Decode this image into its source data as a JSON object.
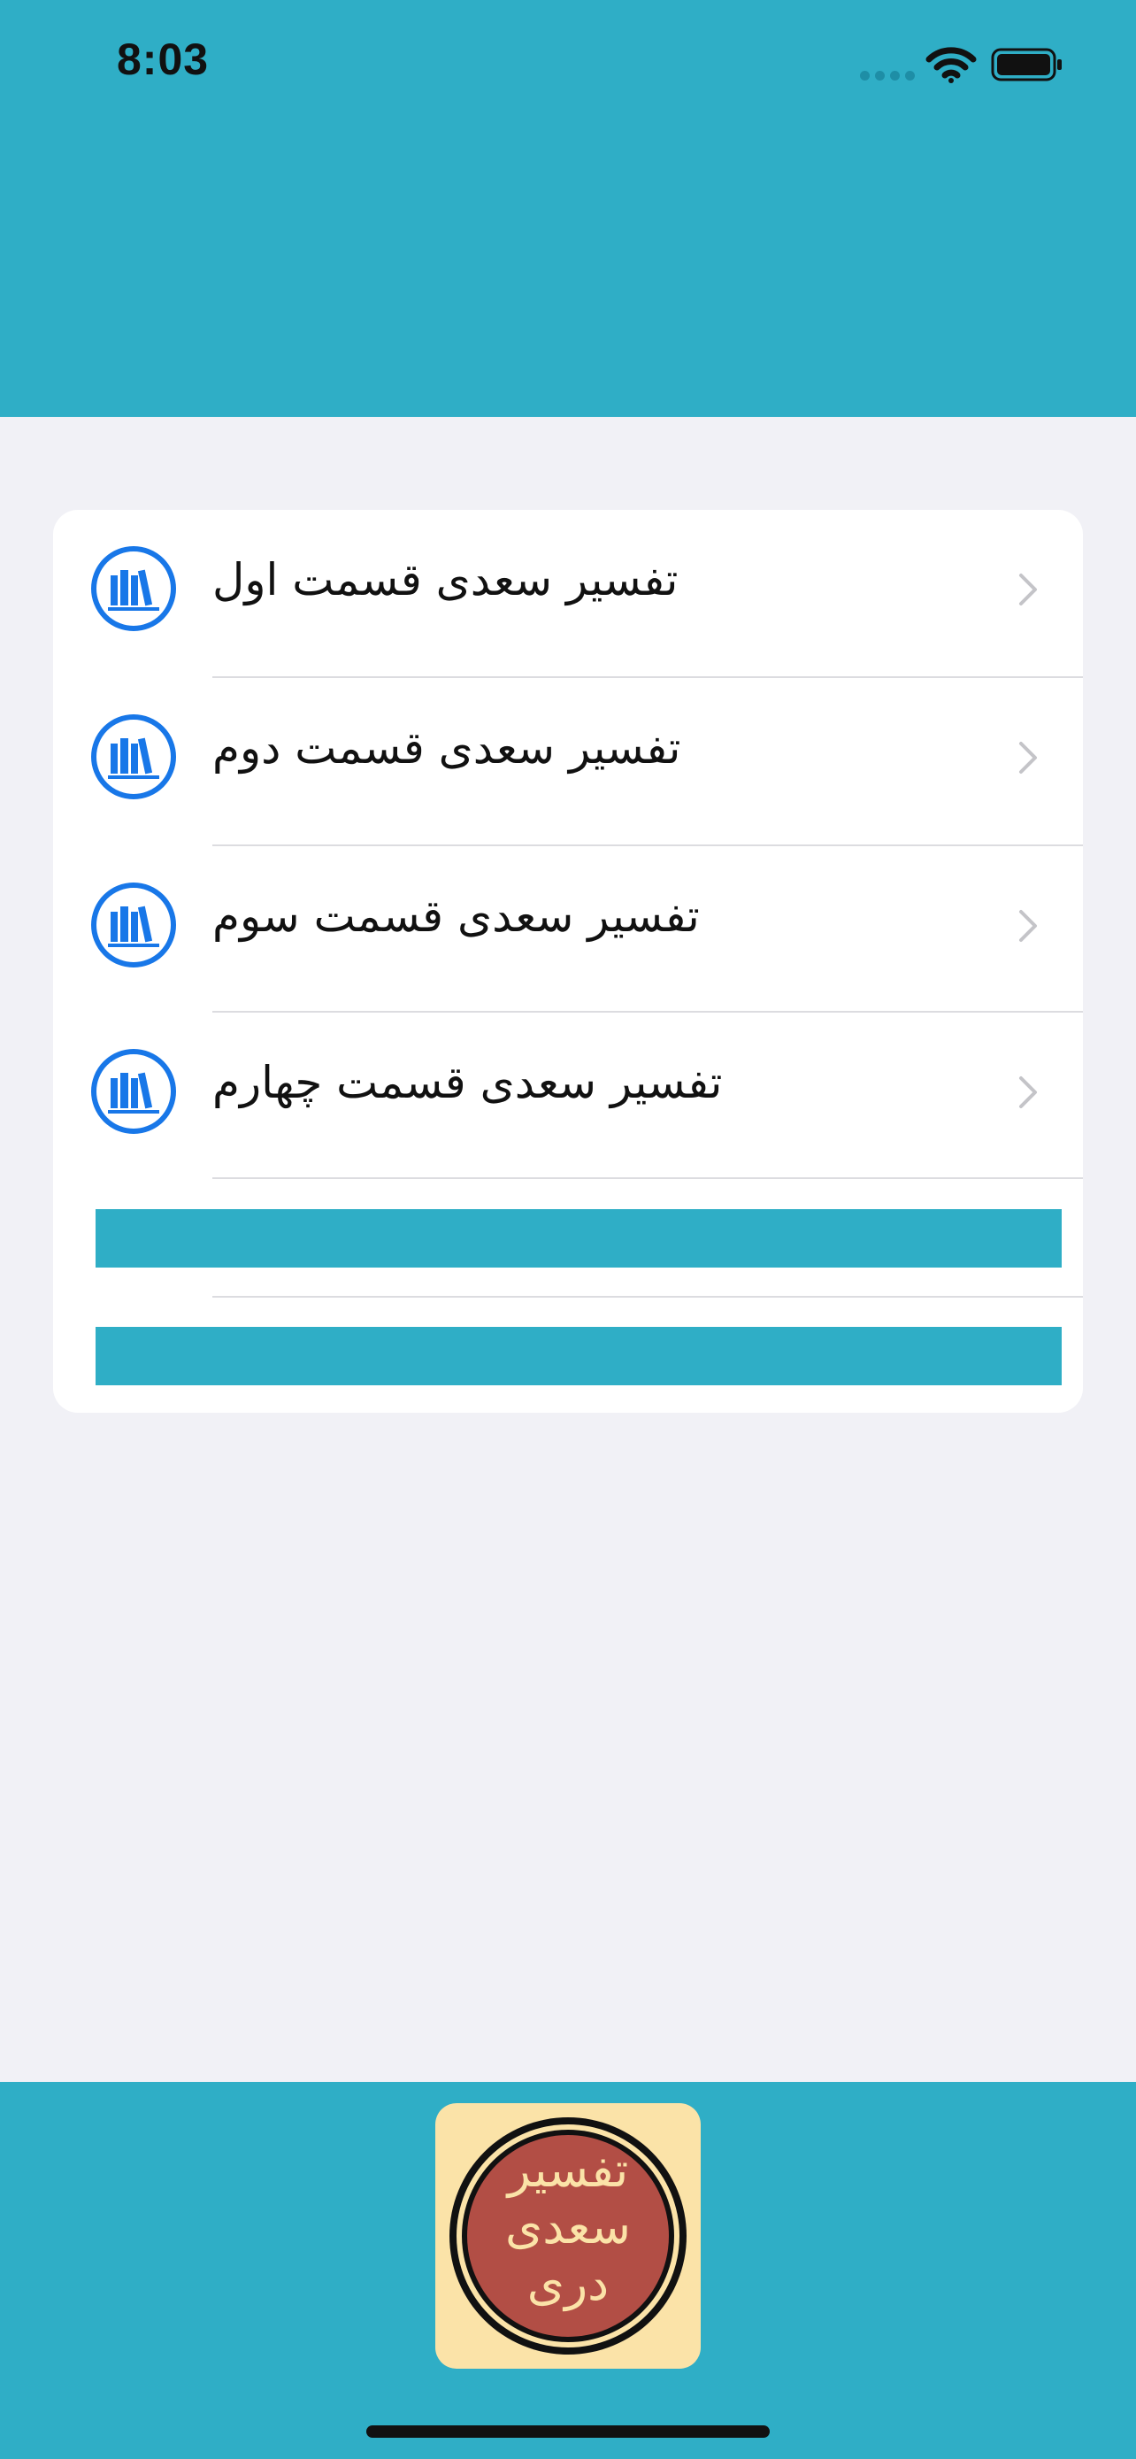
{
  "status_bar": {
    "time": "8:03",
    "icons": [
      "signal-icon",
      "wifi-icon",
      "battery-icon"
    ]
  },
  "colors": {
    "accent": "#2FAEC6",
    "background": "#F1F1F6",
    "icon_blue": "#1877E8",
    "logo_cream": "#FBE3A8",
    "logo_red": "#B24E45"
  },
  "menu": {
    "items": [
      {
        "label": "تفسیر سعدی قسمت اول",
        "icon": "books-icon"
      },
      {
        "label": "تفسیر سعدی قسمت دوم",
        "icon": "books-icon"
      },
      {
        "label": "تفسیر سعدی قسمت سوم",
        "icon": "books-icon"
      },
      {
        "label": "تفسیر سعدی قسمت چهارم",
        "icon": "books-icon"
      }
    ]
  },
  "logo": {
    "lines": [
      "تفسیر",
      "سعدی",
      "دری"
    ]
  }
}
